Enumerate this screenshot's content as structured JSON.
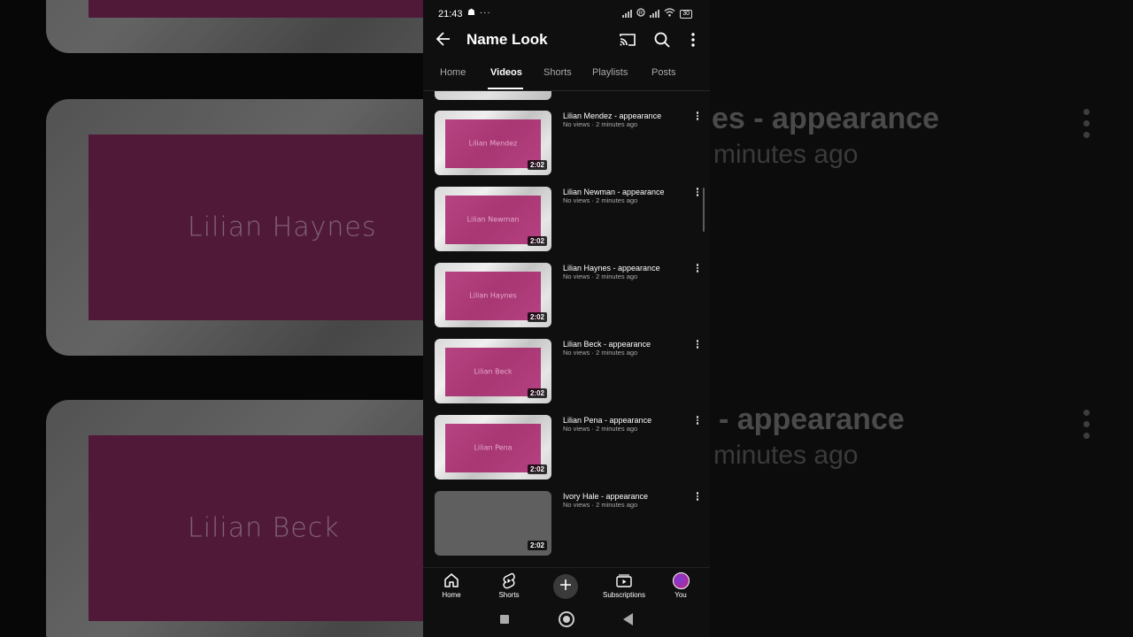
{
  "status_bar": {
    "time": "21:43",
    "left_icons": "☗ ···",
    "battery": "30"
  },
  "app_bar": {
    "title": "Name Look"
  },
  "tabs": [
    {
      "label": "Home"
    },
    {
      "label": "Videos"
    },
    {
      "label": "Shorts"
    },
    {
      "label": "Playlists"
    },
    {
      "label": "Posts"
    }
  ],
  "active_tab": "Videos",
  "videos": [
    {
      "title": "Lilian Mendez - appearance",
      "meta": "No views · 2 minutes ago",
      "thumb_text": "Lilian Mendez",
      "duration": "2:02"
    },
    {
      "title": "Lilian Newman - appearance",
      "meta": "No views · 2 minutes ago",
      "thumb_text": "Lilian Newman",
      "duration": "2:02"
    },
    {
      "title": "Lilian Haynes - appearance",
      "meta": "No views · 2 minutes ago",
      "thumb_text": "Lilian Haynes",
      "duration": "2:02"
    },
    {
      "title": "Lilian Beck - appearance",
      "meta": "No views · 2 minutes ago",
      "thumb_text": "Lilian Beck",
      "duration": "2:02"
    },
    {
      "title": "Lilian Pena - appearance",
      "meta": "No views · 2 minutes ago",
      "thumb_text": "Lilian Pena",
      "duration": "2:02"
    },
    {
      "title": "Ivory Hale - appearance",
      "meta": "No views · 2 minutes ago",
      "thumb_text": "",
      "duration": "2:02"
    }
  ],
  "bottom_nav": [
    {
      "label": "Home",
      "icon": "home-icon"
    },
    {
      "label": "Shorts",
      "icon": "shorts-icon"
    },
    {
      "label": "",
      "icon": "create-icon"
    },
    {
      "label": "Subscriptions",
      "icon": "subscriptions-icon"
    },
    {
      "label": "You",
      "icon": "avatar"
    }
  ],
  "background": {
    "thumb_names": [
      "Lilian Haynes",
      "Lilian Beck"
    ],
    "title_fragments": [
      "es - appearance",
      "- appearance"
    ],
    "sub_fragments": [
      "minutes ago",
      "minutes ago"
    ]
  },
  "colors": {
    "app_bg": "#0f0f0f",
    "thumb_pink": "#b23a7b",
    "text_secondary": "#aaaaaa"
  }
}
